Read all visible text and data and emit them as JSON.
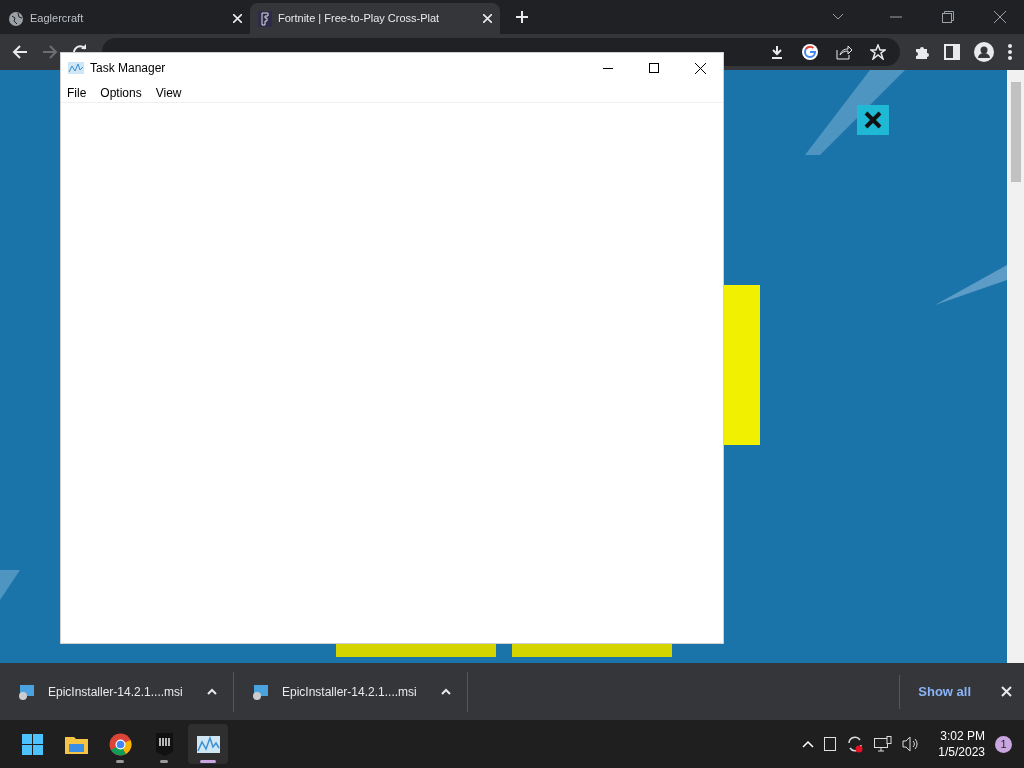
{
  "browser": {
    "tabs": [
      {
        "title": "Eaglercraft",
        "selected": false
      },
      {
        "title": "Fortnite | Free-to-Play Cross-Plat",
        "selected": true
      }
    ]
  },
  "task_manager": {
    "title": "Task Manager",
    "menu": [
      "File",
      "Options",
      "View"
    ]
  },
  "downloads": {
    "items": [
      {
        "name": "EpicInstaller-14.2.1....msi"
      },
      {
        "name": "EpicInstaller-14.2.1....msi"
      }
    ],
    "show_all": "Show all"
  },
  "taskbar": {
    "apps": [
      {
        "kind": "start",
        "running": false,
        "selected": false
      },
      {
        "kind": "explorer",
        "running": false,
        "selected": false
      },
      {
        "kind": "chrome",
        "running": true,
        "selected": false
      },
      {
        "kind": "epic",
        "running": true,
        "selected": false
      },
      {
        "kind": "taskmanager",
        "running": true,
        "selected": true
      }
    ],
    "time": "3:02 PM",
    "date": "1/5/2023",
    "notifications": "1"
  }
}
